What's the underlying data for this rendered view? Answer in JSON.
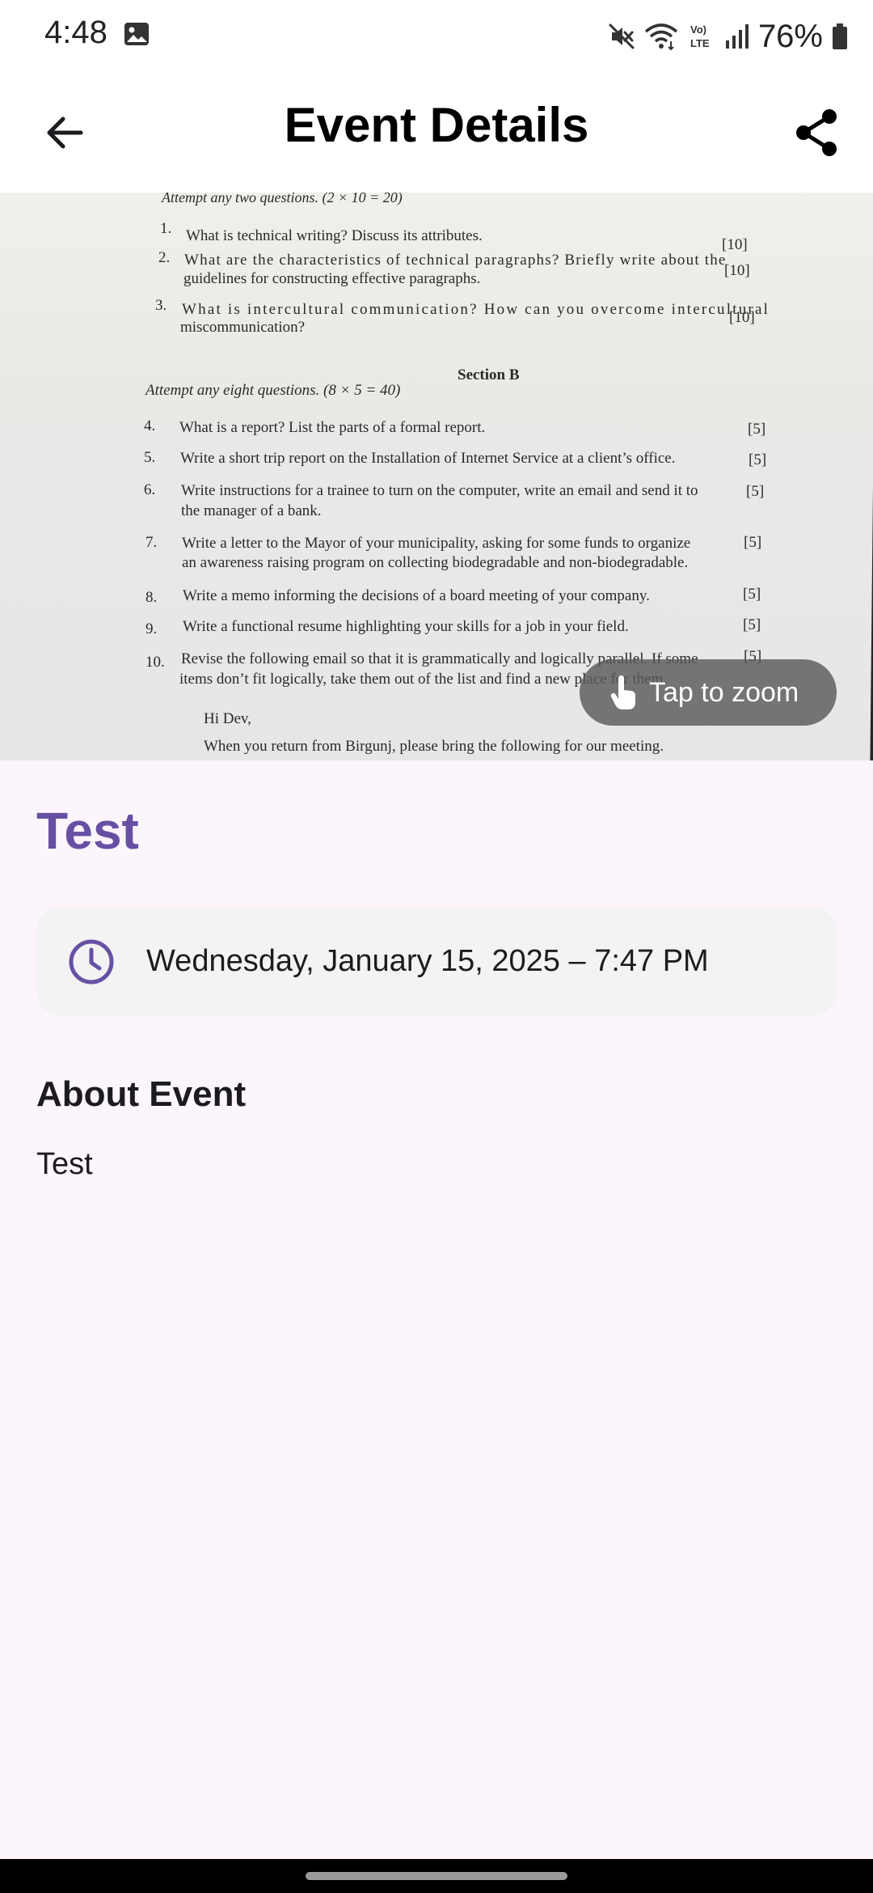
{
  "status_bar": {
    "time": "4:48",
    "battery": "76%",
    "icons": [
      "gallery-icon",
      "mute-icon",
      "wifi-icon",
      "volte-icon",
      "signal-icon",
      "battery-icon"
    ]
  },
  "app_bar": {
    "title": "Event Details",
    "back_icon": "arrow-left-icon",
    "share_icon": "share-icon"
  },
  "photo": {
    "zoom_hint": "Tap to zoom",
    "zoom_icon": "tap-hand-icon",
    "document": {
      "top_instruction": "Attempt any two questions. (2 × 10 = 20)",
      "section_a": [
        {
          "num": "1.",
          "text": [
            "What is technical writing? Discuss its attributes."
          ],
          "mark": "[10]"
        },
        {
          "num": "2.",
          "text": [
            "What are the characteristics of technical paragraphs? Briefly write about the",
            "guidelines for constructing effective paragraphs."
          ],
          "mark": "[10]"
        },
        {
          "num": "3.",
          "text": [
            "What is intercultural communication? How can you overcome intercultural",
            "miscommunication?"
          ],
          "mark": "[10]"
        }
      ],
      "section_b_title": "Section B",
      "section_b_instruction": "Attempt any eight questions. (8 × 5 = 40)",
      "section_b": [
        {
          "num": "4.",
          "text": [
            "What is a report? List the parts of a formal report."
          ],
          "mark": "[5]"
        },
        {
          "num": "5.",
          "text": [
            "Write a short trip report on the Installation of Internet Service at a client’s office."
          ],
          "mark": "[5]"
        },
        {
          "num": "6.",
          "text": [
            "Write instructions for a trainee to turn on the computer, write an email and send it to",
            "the manager of a bank."
          ],
          "mark": "[5]"
        },
        {
          "num": "7.",
          "text": [
            "Write a letter to the Mayor of your municipality, asking for some funds to organize",
            "an awareness raising program on collecting biodegradable and non-biodegradable."
          ],
          "mark": "[5]"
        },
        {
          "num": "8.",
          "text": [
            "Write a memo informing the decisions of a board meeting of your company."
          ],
          "mark": "[5]"
        },
        {
          "num": "9.",
          "text": [
            "Write a functional resume highlighting your skills for a job in your field."
          ],
          "mark": "[5]"
        },
        {
          "num": "10.",
          "text": [
            "Revise the following email so that it is grammatically and logically parallel. If some",
            "items don’t fit logically, take them out of the list and find a new place for them."
          ],
          "mark": "[5]"
        }
      ],
      "email_greeting": "Hi Dev,",
      "email_line": "When you return from Birgunj, please bring the following for our meeting."
    }
  },
  "event": {
    "title": "Test",
    "datetime": "Wednesday, January 15, 2025 – 7:47 PM",
    "datetime_icon": "clock-icon",
    "about_heading": "About Event",
    "about_text": "Test"
  },
  "colors": {
    "accent": "#6750a4",
    "background": "#fcf5fc",
    "card": "#f3f3f3"
  }
}
